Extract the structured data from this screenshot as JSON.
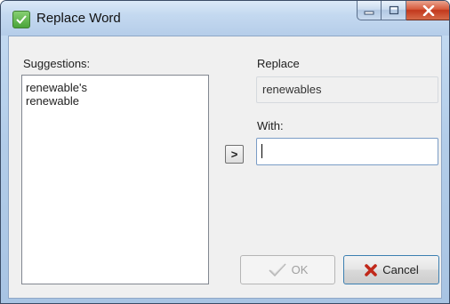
{
  "window": {
    "title": "Replace Word",
    "icon": "spellcheck-app-icon",
    "caption_buttons": [
      "minimize-icon",
      "maximize-icon",
      "close-icon"
    ]
  },
  "suggestions": {
    "label": "Suggestions:",
    "items": [
      "renewable's",
      "renewable"
    ]
  },
  "replace": {
    "label": "Replace",
    "value": "renewables"
  },
  "with": {
    "label": "With:",
    "value": ""
  },
  "arrow_button": {
    "label": ">"
  },
  "buttons": {
    "ok_label": "OK",
    "cancel_label": "Cancel"
  },
  "colors": {
    "title_gradient_top": "#dbe9f7",
    "close_button": "#c2381d",
    "cancel_icon": "#c0281a",
    "ok_icon_disabled": "#b8b8b8"
  }
}
